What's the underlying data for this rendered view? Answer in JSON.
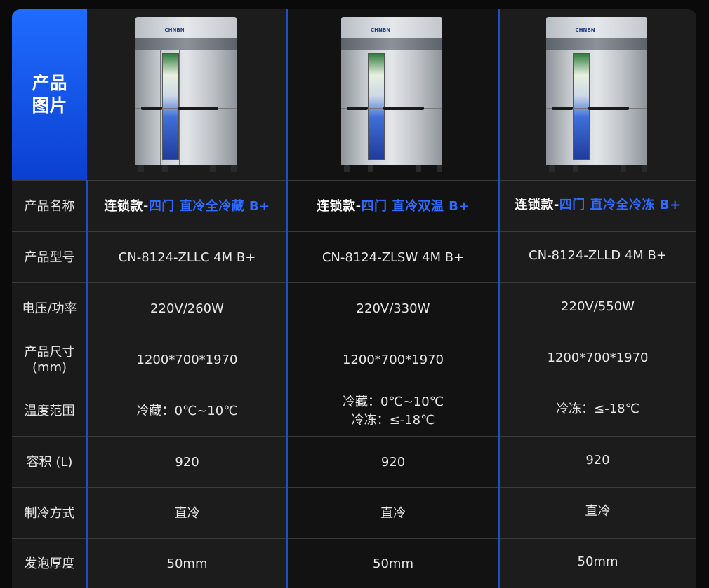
{
  "labels": {
    "image": "产品\n图片",
    "name": "产品名称",
    "model": "产品型号",
    "power": "电压/功率",
    "size": "产品尺寸\n(mm)",
    "temp": "温度范围",
    "volume": "容积 (L)",
    "cooling": "制冷方式",
    "foam": "发泡厚度"
  },
  "products": [
    {
      "image_icon": "refrigerator-icon",
      "brand_text": "CHNBN",
      "name_prefix": "连锁款-",
      "name_suffix": "四门 直冷全冷藏 B+",
      "model": "CN-8124-ZLLC 4M B+",
      "power": "220V/260W",
      "size": "1200*700*1970",
      "temp_lines": [
        "冷藏：0℃~10℃"
      ],
      "volume": "920",
      "cooling": "直冷",
      "foam": "50mm"
    },
    {
      "image_icon": "refrigerator-icon",
      "brand_text": "CHNBN",
      "name_prefix": "连锁款-",
      "name_suffix": "四门 直冷双温 B+",
      "model": "CN-8124-ZLSW 4M B+",
      "power": "220V/330W",
      "size": "1200*700*1970",
      "temp_lines": [
        "冷藏：0℃~10℃",
        "冷冻：≤-18℃"
      ],
      "volume": "920",
      "cooling": "直冷",
      "foam": "50mm"
    },
    {
      "image_icon": "refrigerator-icon",
      "brand_text": "CHNBN",
      "name_prefix": "连锁款-",
      "name_suffix": "四门 直冷全冷冻 B+",
      "model": "CN-8124-ZLLD 4M B+",
      "power": "220V/550W",
      "size": "1200*700*1970",
      "temp_lines": [
        "冷冻：≤-18℃"
      ],
      "volume": "920",
      "cooling": "直冷",
      "foam": "50mm"
    }
  ],
  "colors": {
    "accent_blue": "#2f6bff",
    "header_blue": "#1f6cff",
    "divider_blue": "#1f4fc7"
  }
}
